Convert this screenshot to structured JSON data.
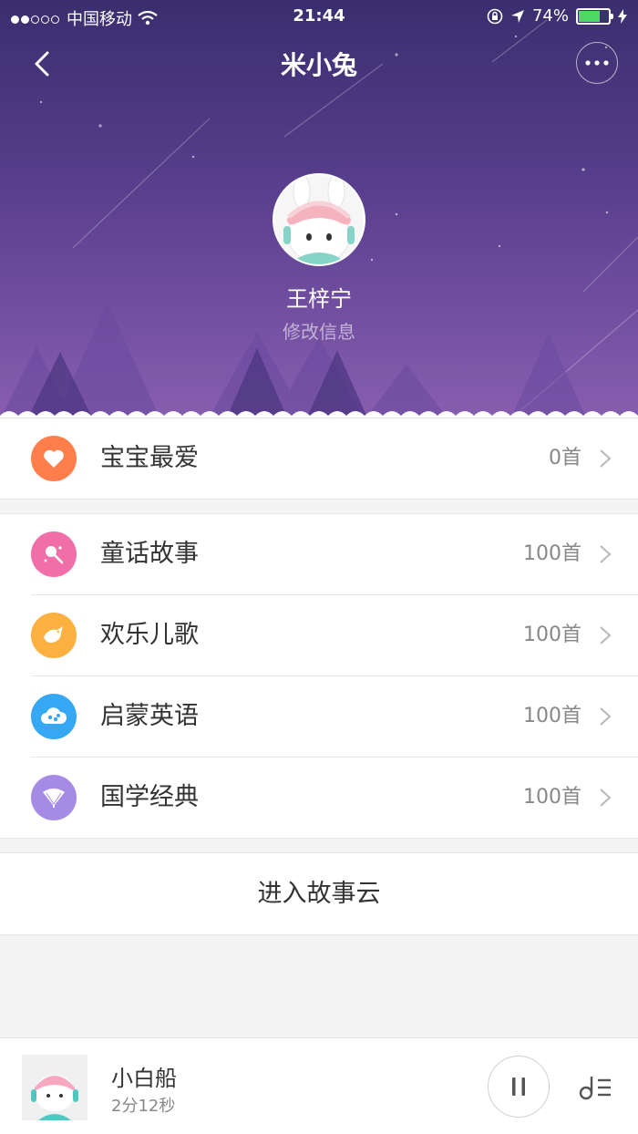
{
  "status_bar": {
    "carrier": "中国移动",
    "time": "21:44",
    "battery": "74%",
    "battery_level": 0.74,
    "signal_dots_filled": 2,
    "signal_dots_total": 5
  },
  "nav": {
    "title": "米小兔",
    "back_icon": "chevron-left-icon",
    "more_icon": "ellipsis-icon"
  },
  "profile": {
    "name": "王梓宁",
    "edit_label": "修改信息"
  },
  "favorites": {
    "label": "宝宝最爱",
    "count": "0首",
    "icon": "heart-icon",
    "color": "#ff7e4c"
  },
  "categories": [
    {
      "label": "童话故事",
      "count": "100首",
      "icon": "magic-wand-icon",
      "color": "#f06fa8"
    },
    {
      "label": "欢乐儿歌",
      "count": "100首",
      "icon": "bird-icon",
      "color": "#fbb040"
    },
    {
      "label": "启蒙英语",
      "count": "100首",
      "icon": "cloud-abc-icon",
      "color": "#35a7f3"
    },
    {
      "label": "国学经典",
      "count": "100首",
      "icon": "fan-icon",
      "color": "#a58ae6"
    }
  ],
  "enter_cloud": {
    "label": "进入故事云"
  },
  "player": {
    "track": "小白船",
    "duration": "2分12秒",
    "pause_icon": "pause-icon",
    "playlist_icon": "playlist-icon"
  }
}
